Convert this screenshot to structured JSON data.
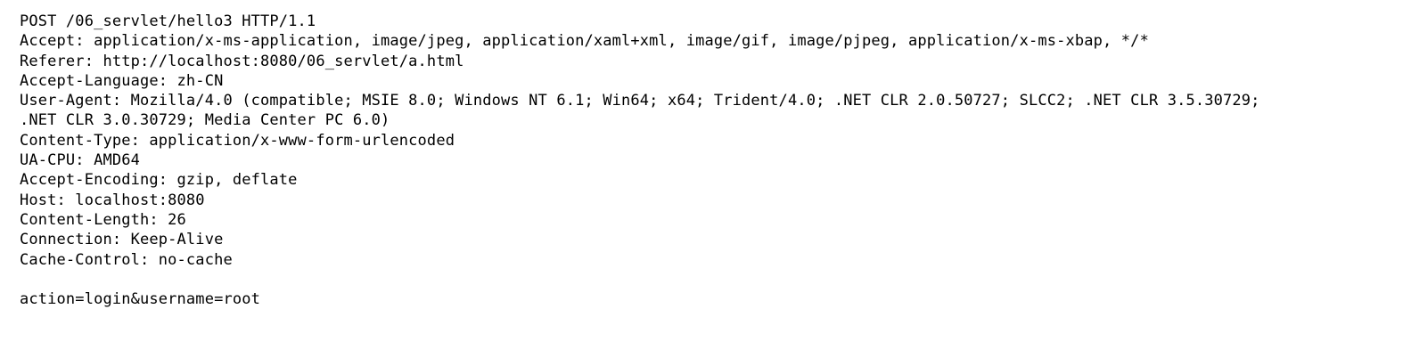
{
  "request_line": "POST /06_servlet/hello3 HTTP/1.1",
  "headers": [
    "Accept: application/x-ms-application, image/jpeg, application/xaml+xml, image/gif, image/pjpeg, application/x-ms-xbap, */*",
    "Referer: http://localhost:8080/06_servlet/a.html",
    "Accept-Language: zh-CN",
    "User-Agent: Mozilla/4.0 (compatible; MSIE 8.0; Windows NT 6.1; Win64; x64; Trident/4.0; .NET CLR 2.0.50727; SLCC2; .NET CLR 3.5.30729;",
    ".NET CLR 3.0.30729; Media Center PC 6.0)",
    "Content-Type: application/x-www-form-urlencoded",
    "UA-CPU: AMD64",
    "Accept-Encoding: gzip, deflate",
    "Host: localhost:8080",
    "Content-Length: 26",
    "Connection: Keep-Alive",
    "Cache-Control: no-cache"
  ],
  "body": "action=login&username=root"
}
